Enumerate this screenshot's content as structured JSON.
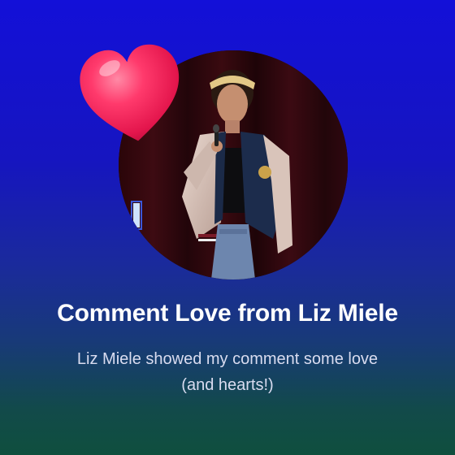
{
  "card": {
    "title": "Comment Love from Liz Miele",
    "subtitle_line1": "Liz Miele showed my comment some love",
    "subtitle_line2": "(and hearts!)",
    "avatar_icon": "profile-photo",
    "heart_icon": "heart-icon"
  },
  "colors": {
    "background_top": "#1310d8",
    "background_bottom": "#0f4f3e",
    "heart": "#ff2d62",
    "text_primary": "#ffffff",
    "text_secondary": "#d9dcf0"
  }
}
